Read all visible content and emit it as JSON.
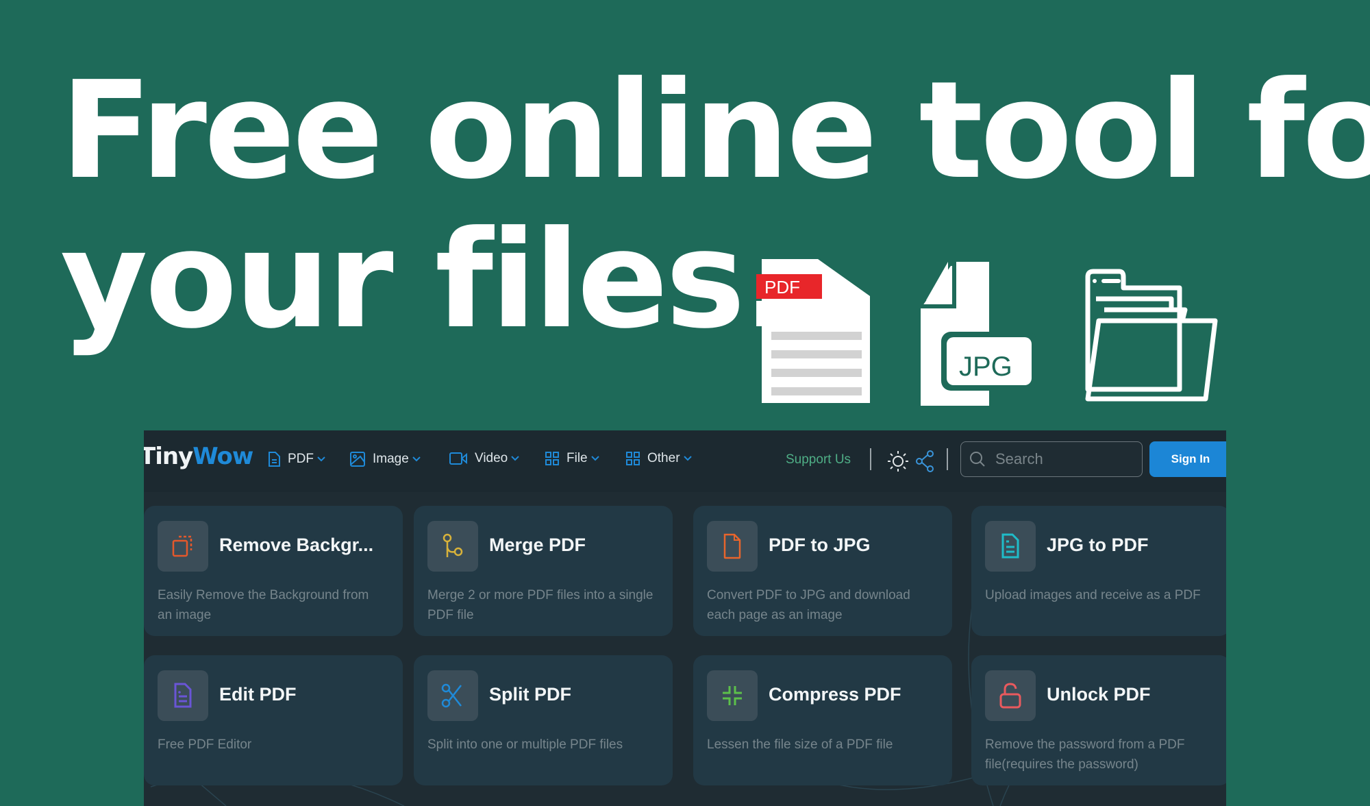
{
  "headline": {
    "line1": "Free online tool for",
    "line2": "your files."
  },
  "file_icons": [
    {
      "name": "pdf-file-icon",
      "label": "PDF",
      "color": "#e8262a"
    },
    {
      "name": "jpg-file-icon",
      "label": "JPG"
    },
    {
      "name": "folder-icon",
      "label": ""
    }
  ],
  "app": {
    "logo": {
      "part1": "Tiny",
      "part2": "Wow"
    },
    "nav": [
      {
        "label": "PDF",
        "icon": "document-icon"
      },
      {
        "label": "Image",
        "icon": "image-icon"
      },
      {
        "label": "Video",
        "icon": "video-icon"
      },
      {
        "label": "File",
        "icon": "grid-icon"
      },
      {
        "label": "Other",
        "icon": "grid-icon"
      }
    ],
    "support_label": "Support Us",
    "search": {
      "placeholder": "Search",
      "value": ""
    },
    "signin_label": "Sign In",
    "colors": {
      "accent": "#1c86d6",
      "support": "#4fae86",
      "card_bg": "#223945",
      "page_bg": "#1e6a59"
    }
  },
  "tools": [
    {
      "title": "Remove Backgr...",
      "desc": "Easily Remove the Background from an image",
      "icon": "remove-background-icon",
      "color": "#e5582b"
    },
    {
      "title": "Merge PDF",
      "desc": "Merge 2 or more PDF files into a single PDF file",
      "icon": "merge-icon",
      "color": "#d8b23a"
    },
    {
      "title": "PDF to JPG",
      "desc": "Convert PDF to JPG and download each page as an image",
      "icon": "file-icon",
      "color": "#e8652c"
    },
    {
      "title": "JPG to PDF",
      "desc": "Upload images and receive as a PDF",
      "icon": "file-text-icon",
      "color": "#1fbcc9"
    },
    {
      "title": "Edit PDF",
      "desc": "Free PDF Editor",
      "icon": "edit-document-icon",
      "color": "#6a55d6"
    },
    {
      "title": "Split PDF",
      "desc": "Split into one or multiple PDF files",
      "icon": "scissors-icon",
      "color": "#1f8ad8"
    },
    {
      "title": "Compress PDF",
      "desc": "Lessen the file size of a PDF file",
      "icon": "compress-icon",
      "color": "#5cc04a"
    },
    {
      "title": "Unlock PDF",
      "desc": "Remove the password from a PDF file(requires the password)",
      "icon": "unlock-icon",
      "color": "#e95a5e"
    }
  ]
}
